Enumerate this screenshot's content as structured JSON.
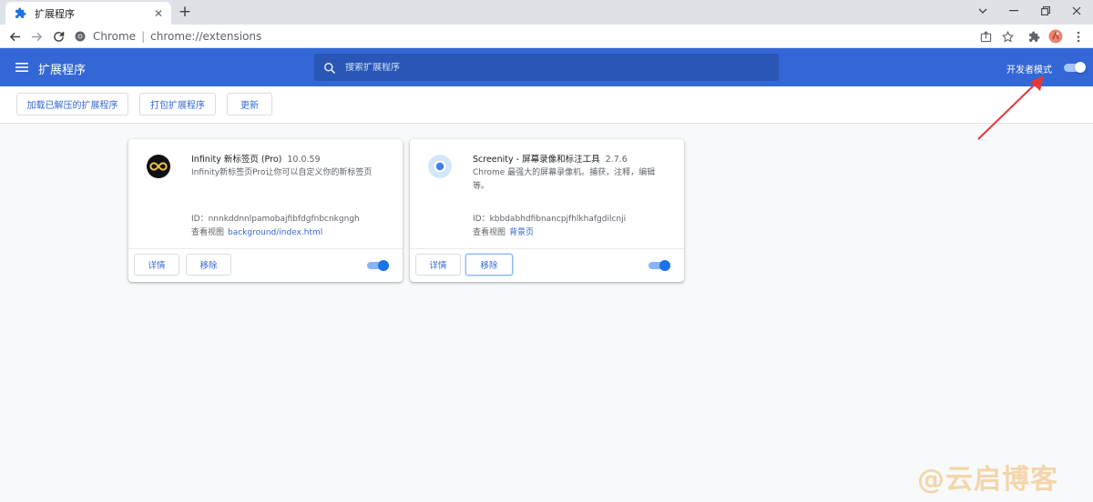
{
  "browser": {
    "tab_title": "扩展程序",
    "omnibox_site": "Chrome",
    "omnibox_url": "chrome://extensions"
  },
  "header": {
    "title": "扩展程序",
    "search_placeholder": "搜索扩展程序",
    "dev_mode_label": "开发者模式",
    "dev_mode_on": true
  },
  "actions": {
    "load_unpacked": "加载已解压的扩展程序",
    "pack": "打包扩展程序",
    "update": "更新"
  },
  "extensions": [
    {
      "name": "Infinity 新标签页 (Pro)",
      "version": "10.0.59",
      "description": "Infinity新标签页Pro让你可以自定义你的新标签页",
      "id_line": "ID：nnnkddnnlpamobajfibfdgfnbcnkgngh",
      "view_label": "查看视图",
      "view_link": "background/index.html",
      "details_label": "详情",
      "remove_label": "移除",
      "enabled": true
    },
    {
      "name": "Screenity - 屏幕录像和标注工具",
      "version": "2.7.6",
      "description": "Chrome 最强大的屏幕录像机。捕获，注释，编辑等。",
      "id_line": "ID：kbbdabhdfibnancpjfhlkhafgdilcnji",
      "view_label": "查看视图",
      "view_link": "背景页",
      "details_label": "详情",
      "remove_label": "移除",
      "enabled": true
    }
  ],
  "watermark": "@云启博客",
  "colors": {
    "header_bg": "#3367d6",
    "accent": "#1a73e8",
    "watermark": "#f2b96b"
  }
}
